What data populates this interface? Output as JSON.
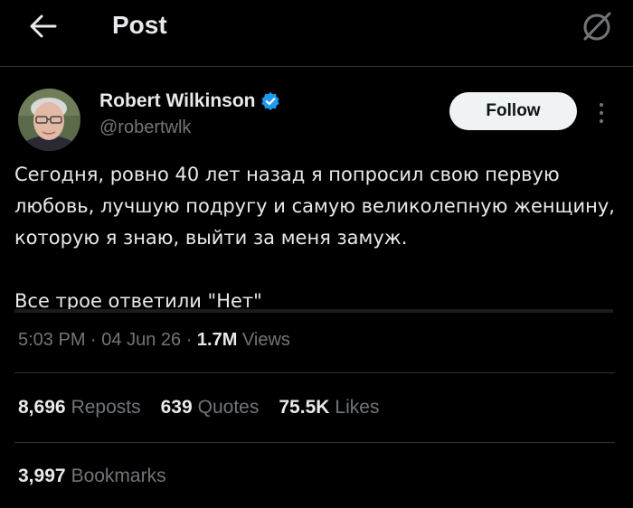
{
  "header": {
    "title": "Post",
    "back_icon": "arrow-left-icon",
    "grok_icon": "grok-icon"
  },
  "author": {
    "display_name": "Robert Wilkinson",
    "handle": "@robertwlk",
    "verified": true,
    "verified_color": "#1d9bf0",
    "follow_label": "Follow"
  },
  "tweet": {
    "paragraph1": "Сегодня, ровно 40 лет назад я попросил свою первую любовь, лучшую подругу и самую великолепную женщину, которую я знаю, выйти за меня замуж.",
    "paragraph2": "Все трое ответили \"Нет\""
  },
  "meta": {
    "time": "5:03 PM",
    "date": "04 Jun 26",
    "views_count": "1.7M",
    "views_label": "Views"
  },
  "stats": {
    "reposts_count": "8,696",
    "reposts_label": "Reposts",
    "quotes_count": "639",
    "quotes_label": "Quotes",
    "likes_count": "75.5K",
    "likes_label": "Likes",
    "bookmarks_count": "3,997",
    "bookmarks_label": "Bookmarks"
  },
  "colors": {
    "background": "#000000",
    "text": "#e7e9ea",
    "muted": "#71767b",
    "border": "#2f3336",
    "accent": "#1d9bf0"
  }
}
